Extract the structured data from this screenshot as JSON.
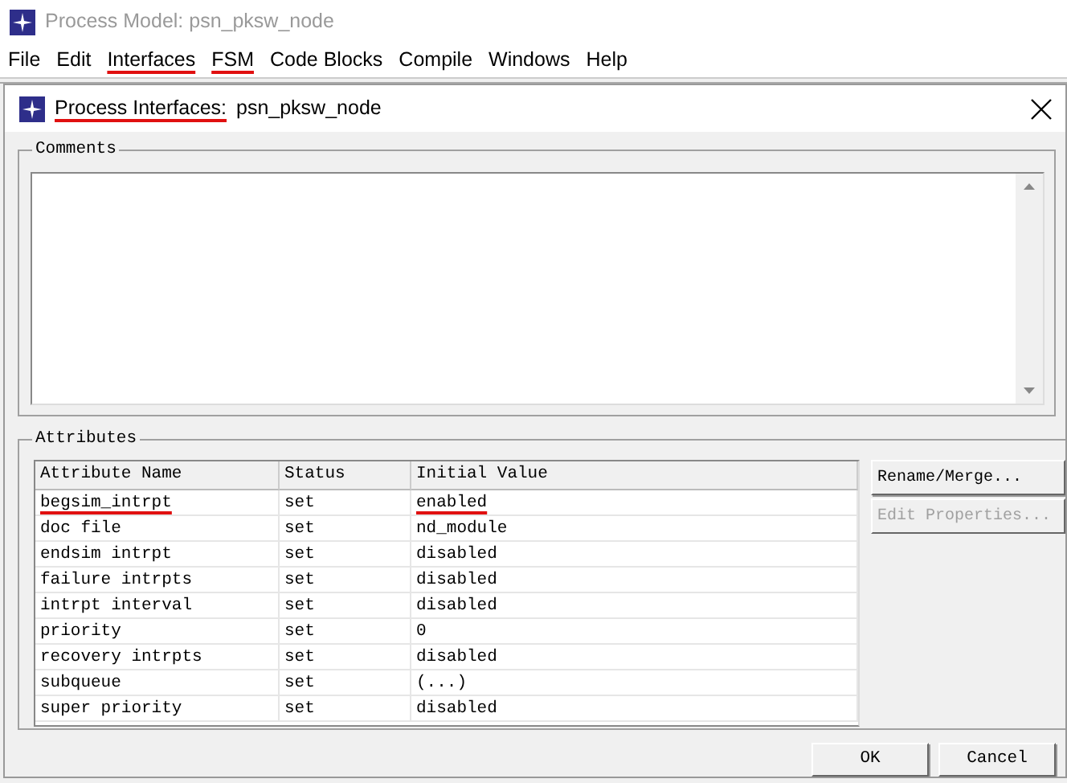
{
  "app_window": {
    "title": "Process Model: psn_pksw_node"
  },
  "menu": [
    {
      "label": "File",
      "underlined": false
    },
    {
      "label": "Edit",
      "underlined": false
    },
    {
      "label": "Interfaces",
      "underlined": true
    },
    {
      "label": "FSM",
      "underlined": true
    },
    {
      "label": "Code Blocks",
      "underlined": false
    },
    {
      "label": "Compile",
      "underlined": false
    },
    {
      "label": "Windows",
      "underlined": false
    },
    {
      "label": "Help",
      "underlined": false
    }
  ],
  "dialog": {
    "title_parts": [
      {
        "text": "Process Interfaces:",
        "underlined": true
      },
      {
        "text": "psn_pksw_node",
        "underlined": false
      }
    ],
    "comments": {
      "label": "Comments"
    },
    "attributes": {
      "label": "Attributes",
      "columns": [
        "Attribute Name",
        "Status",
        "Initial Value"
      ],
      "rows": [
        {
          "cells": [
            {
              "text": "begsim_intrpt",
              "underlined": true
            },
            {
              "text": "set",
              "underlined": false
            },
            {
              "text": "enabled",
              "underlined": true
            }
          ]
        },
        {
          "cells": [
            {
              "text": "doc file",
              "underlined": false
            },
            {
              "text": "set",
              "underlined": false
            },
            {
              "text": "nd_module",
              "underlined": false
            }
          ]
        },
        {
          "cells": [
            {
              "text": "endsim intrpt",
              "underlined": false
            },
            {
              "text": "set",
              "underlined": false
            },
            {
              "text": "disabled",
              "underlined": false
            }
          ]
        },
        {
          "cells": [
            {
              "text": "failure intrpts",
              "underlined": false
            },
            {
              "text": "set",
              "underlined": false
            },
            {
              "text": "disabled",
              "underlined": false
            }
          ]
        },
        {
          "cells": [
            {
              "text": "intrpt interval",
              "underlined": false
            },
            {
              "text": "set",
              "underlined": false
            },
            {
              "text": "disabled",
              "underlined": false
            }
          ]
        },
        {
          "cells": [
            {
              "text": "priority",
              "underlined": false
            },
            {
              "text": "set",
              "underlined": false
            },
            {
              "text": "0",
              "underlined": false
            }
          ]
        },
        {
          "cells": [
            {
              "text": "recovery intrpts",
              "underlined": false
            },
            {
              "text": "set",
              "underlined": false
            },
            {
              "text": "disabled",
              "underlined": false
            }
          ]
        },
        {
          "cells": [
            {
              "text": "subqueue",
              "underlined": false
            },
            {
              "text": "set",
              "underlined": false
            },
            {
              "text": "(...)",
              "underlined": false
            }
          ]
        },
        {
          "cells": [
            {
              "text": "super priority",
              "underlined": false
            },
            {
              "text": "set",
              "underlined": false
            },
            {
              "text": "disabled",
              "underlined": false
            }
          ]
        }
      ],
      "side_buttons": [
        {
          "label": "Rename/Merge...",
          "disabled": false
        },
        {
          "label": "Edit Properties...",
          "disabled": true
        }
      ]
    },
    "buttons": [
      {
        "label": "OK"
      },
      {
        "label": "Cancel"
      }
    ]
  }
}
